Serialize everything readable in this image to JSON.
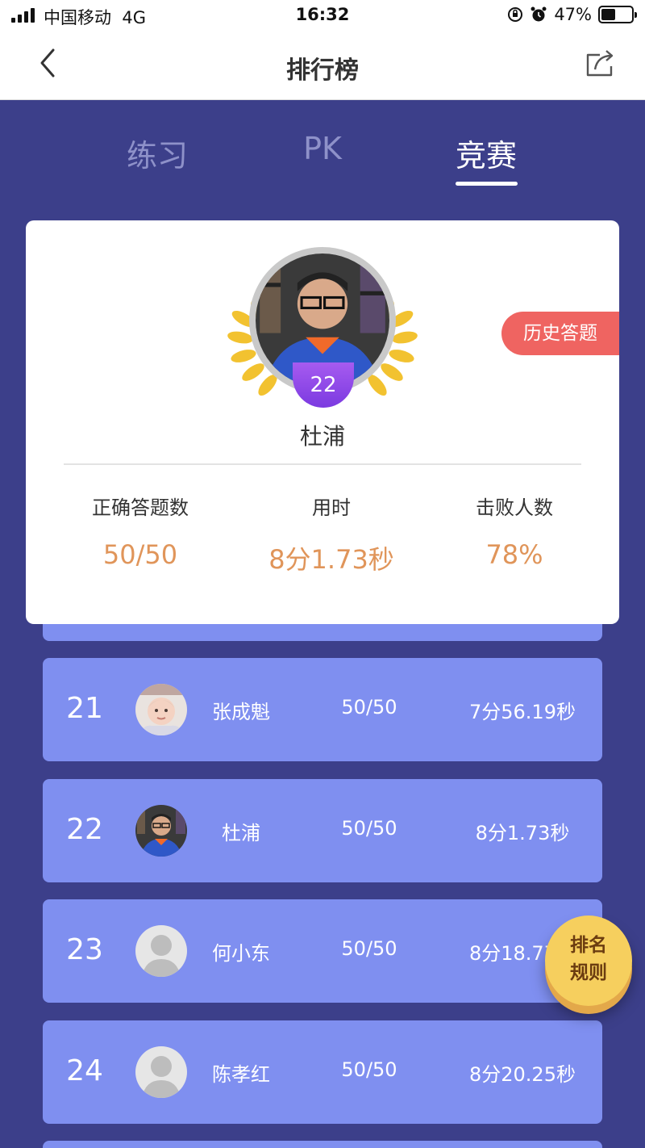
{
  "status_bar": {
    "carrier": "中国移动",
    "network": "4G",
    "time": "16:32",
    "battery_percent": "47%",
    "battery_level": 0.47
  },
  "nav": {
    "title": "排行榜"
  },
  "tabs": [
    {
      "label": "练习",
      "active": false
    },
    {
      "label": "PK",
      "active": false
    },
    {
      "label": "竞赛",
      "active": true
    }
  ],
  "user_card": {
    "rank": "22",
    "name": "杜浦",
    "history_button": "历史答题",
    "stats": [
      {
        "label": "正确答题数",
        "value": "50/50"
      },
      {
        "label": "用时",
        "value": "8分1.73秒"
      },
      {
        "label": "击败人数",
        "value": "78%"
      }
    ]
  },
  "leaderboard": [
    {
      "rank": "21",
      "name": "张成魁",
      "score": "50/50",
      "time": "7分56.19秒",
      "avatar": "baby-photo"
    },
    {
      "rank": "22",
      "name": "杜浦",
      "score": "50/50",
      "time": "8分1.73秒",
      "avatar": "user-photo"
    },
    {
      "rank": "23",
      "name": "何小东",
      "score": "50/50",
      "time": "8分18.77秒",
      "avatar": "default"
    },
    {
      "rank": "24",
      "name": "陈孝红",
      "score": "50/50",
      "time": "8分20.25秒",
      "avatar": "default"
    }
  ],
  "rules_button": {
    "line1": "排名",
    "line2": "规则"
  },
  "colors": {
    "background": "#3c3f8a",
    "row": "#7f8ff0",
    "accent_orange": "#e0955a",
    "history_red": "#ef6461",
    "badge_purple": "#8b45e8",
    "rules_yellow": "#f6cf5e"
  }
}
